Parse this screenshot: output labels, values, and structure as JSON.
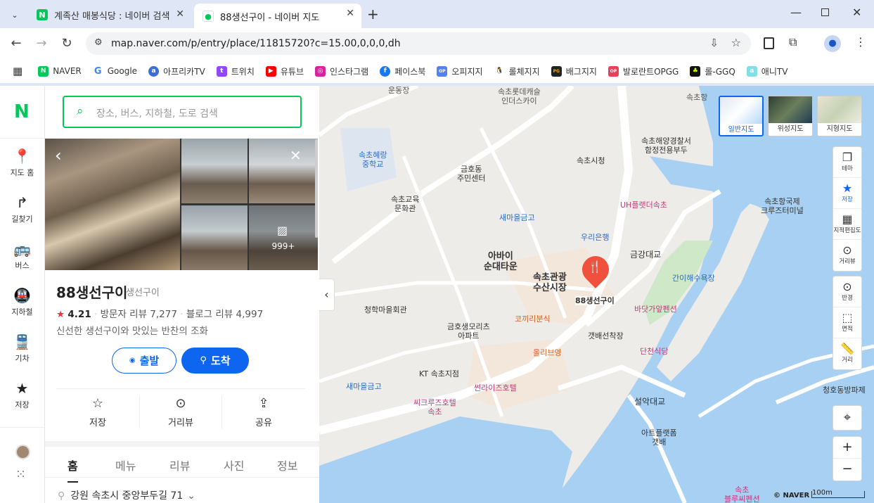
{
  "browser": {
    "tabs": [
      {
        "title": "계족산 매봉식당 : 네이버 검색"
      },
      {
        "title": "88생선구이 - 네이버 지도"
      }
    ],
    "url": "map.naver.com/p/entry/place/11815720?c=15.00,0,0,0,dh",
    "bookmarks": [
      "NAVER",
      "Google",
      "아프리카TV",
      "트위치",
      "유튜브",
      "인스타그램",
      "페이스북",
      "오피지지",
      "롤체지지",
      "배그지지",
      "발로란트OPGG",
      "롤-GGQ",
      "애니TV"
    ]
  },
  "leftnav": {
    "logo": "N",
    "items": [
      "지도 홈",
      "길찾기",
      "버스",
      "지하철",
      "기차",
      "저장"
    ]
  },
  "panel": {
    "search_placeholder": "장소, 버스, 지하철, 도로 검색",
    "photo_count": "999+",
    "name": "88생선구이",
    "category": "생선구이",
    "rating": "4.21",
    "visitor_reviews": "방문자 리뷰 7,277",
    "blog_reviews": "블로그 리뷰 4,997",
    "description": "신선한 생선구이와 맛있는 반찬의 조화",
    "depart": "출발",
    "arrive": "도착",
    "actions": [
      "저장",
      "거리뷰",
      "공유"
    ],
    "tabs": [
      "홈",
      "메뉴",
      "리뷰",
      "사진",
      "정보"
    ],
    "address": "강원 속초시 중앙부두길 71"
  },
  "map": {
    "types": [
      "일반지도",
      "위성지도",
      "지형지도"
    ],
    "controls": [
      "테마",
      "저장",
      "지적편집도",
      "거리뷰",
      "반경",
      "면적",
      "거리"
    ],
    "attribution": "© NAVER",
    "scale": "100m",
    "labels": {
      "l1": "운동장",
      "l2": "속초롯데캐슬\n인더스카이",
      "l3": "속초항",
      "l4": "속초혜랑\n중학교",
      "l5": "금호동\n주민센터",
      "l6": "속초해양경찰서\n함정전용부두",
      "l7": "속초시청",
      "l8": "속초교육\n문화관",
      "l9": "새마을금고",
      "l10": "UH플랫더속초",
      "l11": "속초항국제\n크루즈터미널",
      "l12": "우리은행",
      "l13": "아바이\n순대타운",
      "l14": "속초관광\n수산시장",
      "l15": "금강대교",
      "l16": "간이해수욕장",
      "l17": "88생선구이",
      "l18": "청학마을회관",
      "l19": "바닷가앞펜션",
      "l20": "코끼리분식",
      "l21": "금호생모리츠\n아파트",
      "l22": "갯배선착장",
      "l23": "올리브영",
      "l24": "단천식당",
      "l25": "KT 속초지점",
      "l26": "새마을금고",
      "l27": "썬라이즈호텔",
      "l28": "씨크루즈호텔\n속초",
      "l29": "설악대교",
      "l30": "청호동방파제",
      "l31": "아트플랫폼\n갯배",
      "l32": "속초\n블루씨펜션"
    }
  }
}
